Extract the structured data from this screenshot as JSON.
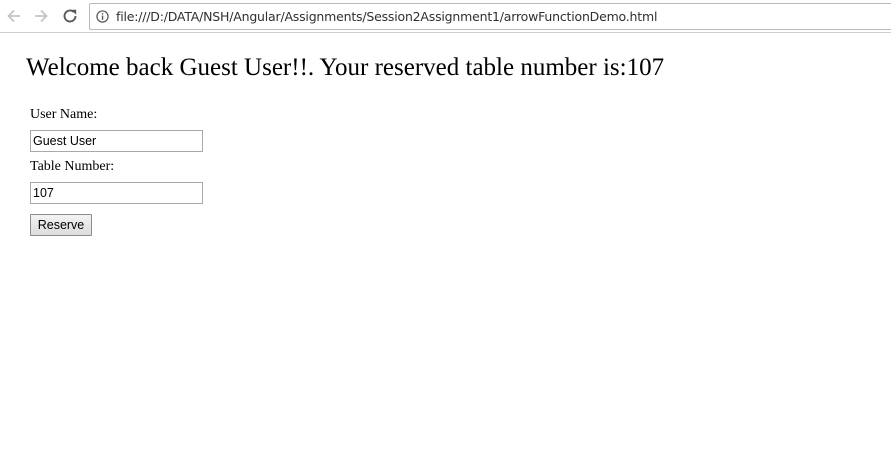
{
  "browser": {
    "url": "file:///D:/DATA/NSH/Angular/Assignments/Session2Assignment1/arrowFunctionDemo.html",
    "nav_icons": [
      "back-arrow-icon",
      "forward-arrow-icon",
      "reload-icon",
      "info-icon"
    ]
  },
  "page": {
    "heading": "Welcome back Guest User!!. Your reserved table number is:107",
    "form": {
      "username_label": "User Name:",
      "username_value": "Guest User",
      "tablenumber_label": "Table Number:",
      "tablenumber_value": "107",
      "reserve_label": "Reserve"
    }
  }
}
